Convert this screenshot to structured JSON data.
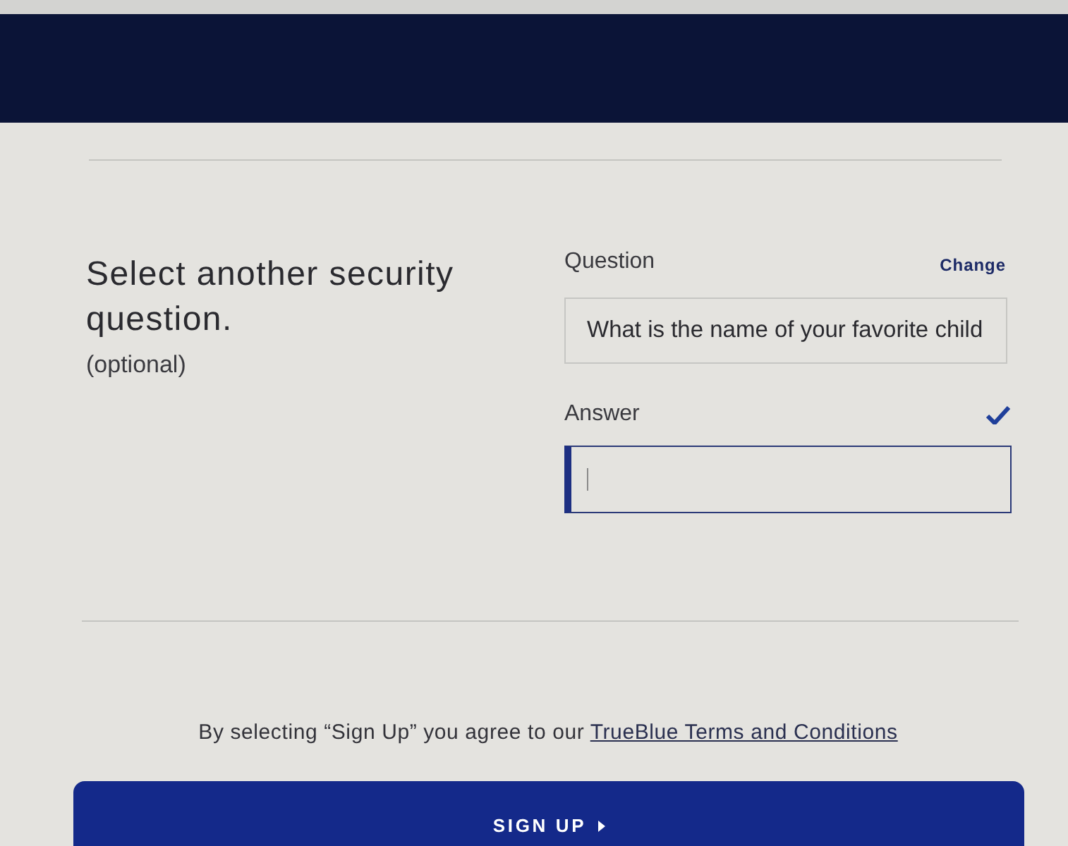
{
  "security_question": {
    "heading": "Select another security question.",
    "note": "(optional)",
    "question": {
      "label": "Question",
      "action": "Change",
      "value": "What is the name of your favorite child"
    },
    "answer": {
      "label": "Answer",
      "valid": true,
      "focused": true
    }
  },
  "terms": {
    "text": "By selecting “Sign Up” you agree to our",
    "link": "TrueBlue Terms and Conditions"
  },
  "submit": {
    "label": "SIGN UP"
  }
}
